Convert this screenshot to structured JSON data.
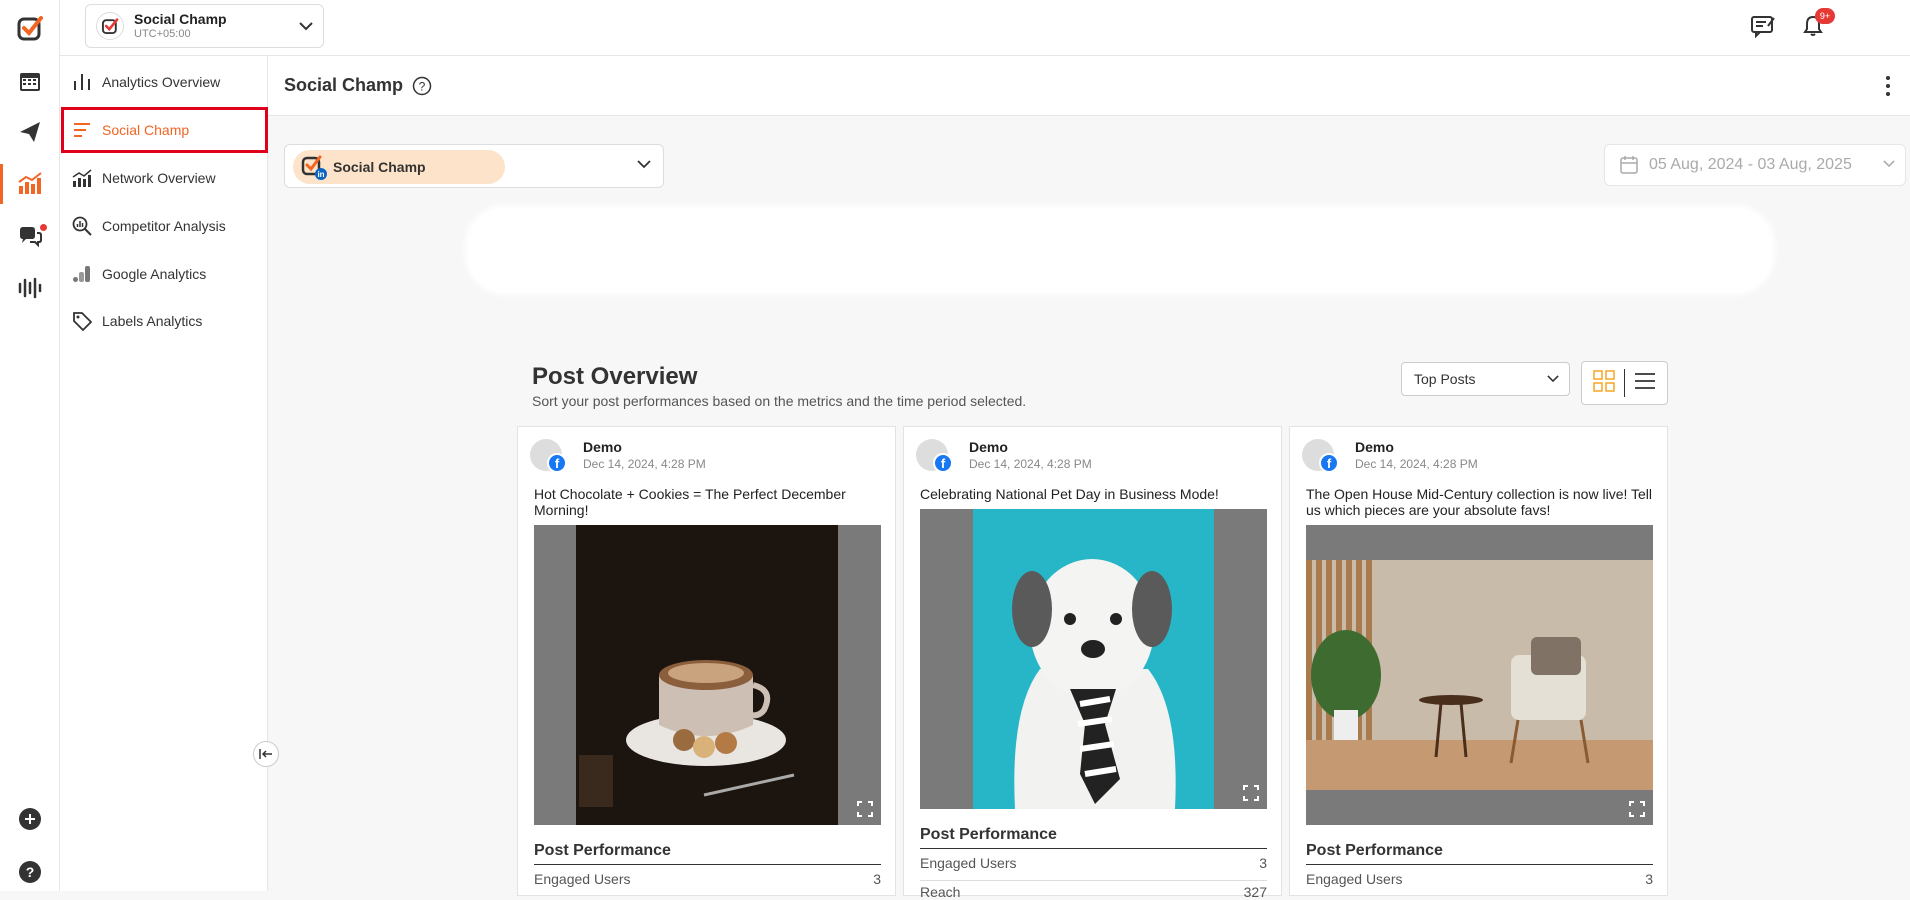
{
  "rail": {
    "items": [
      {
        "icon": "calendar-icon"
      },
      {
        "icon": "send-icon"
      },
      {
        "icon": "analytics-icon"
      },
      {
        "icon": "chat-icon"
      },
      {
        "icon": "audio-wave-icon"
      },
      {
        "icon": "plus-circle-icon"
      },
      {
        "icon": "help-circle-icon"
      }
    ]
  },
  "workspace": {
    "name": "Social Champ",
    "timezone": "UTC+05:00"
  },
  "notifications": {
    "badge": "9+"
  },
  "subnav": {
    "items": [
      {
        "label": "Analytics Overview"
      },
      {
        "label": "Social Champ"
      },
      {
        "label": "Network Overview"
      },
      {
        "label": "Competitor Analysis"
      },
      {
        "label": "Google Analytics"
      },
      {
        "label": "Labels Analytics"
      }
    ]
  },
  "page": {
    "title": "Social Champ"
  },
  "filters": {
    "account": "Social Champ",
    "date_range": "05 Aug, 2024 - 03 Aug, 2025"
  },
  "post_overview": {
    "title": "Post Overview",
    "subtitle": "Sort your post performances based on the metrics and the time period selected.",
    "sort_value": "Top Posts"
  },
  "posts": [
    {
      "author": "Demo",
      "date": "Dec 14, 2024, 4:28 PM",
      "text": "Hot Chocolate + Cookies = The Perfect December Morning!",
      "performance_title": "Post Performance",
      "metrics": [
        {
          "label": "Engaged Users",
          "value": "3"
        }
      ]
    },
    {
      "author": "Demo",
      "date": "Dec 14, 2024, 4:28 PM",
      "text": "Celebrating National Pet Day in Business Mode!",
      "performance_title": "Post Performance",
      "metrics": [
        {
          "label": "Engaged Users",
          "value": "3"
        },
        {
          "label": "Reach",
          "value": "327"
        }
      ]
    },
    {
      "author": "Demo",
      "date": "Dec 14, 2024, 4:28 PM",
      "text": "The Open House Mid-Century collection is now live! Tell us which pieces are your absolute favs!",
      "performance_title": "Post Performance",
      "metrics": [
        {
          "label": "Engaged Users",
          "value": "3"
        }
      ]
    }
  ],
  "colors": {
    "accent": "#f26522",
    "highlight_border": "#e0001b",
    "facebook": "#1877f2",
    "chip": "#fde3c9"
  }
}
